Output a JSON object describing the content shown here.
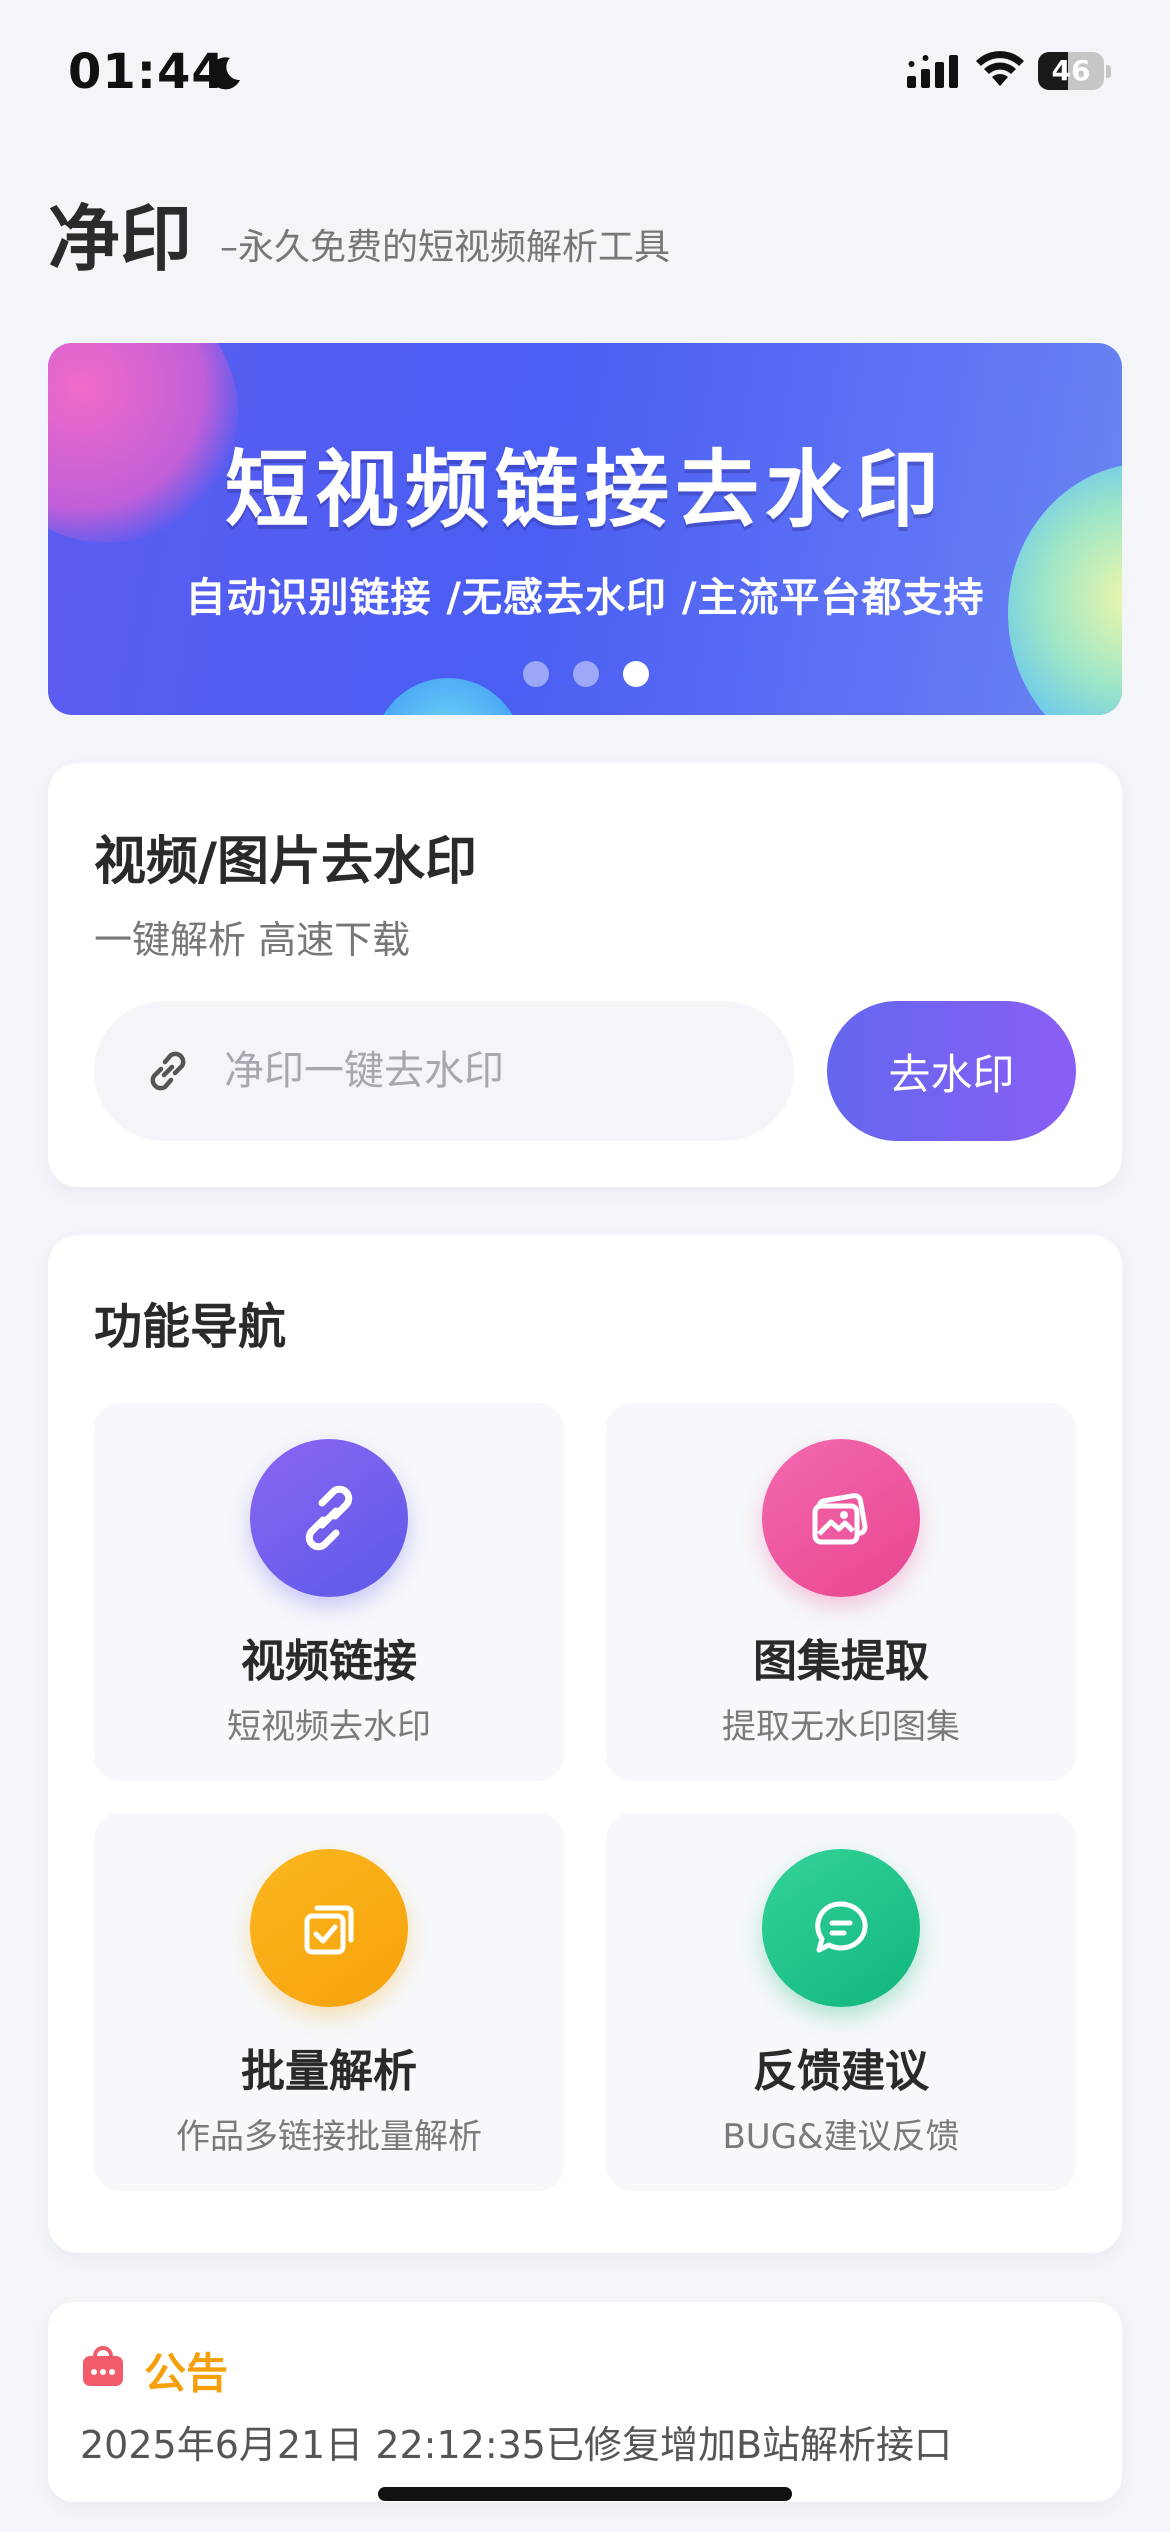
{
  "status_bar": {
    "time": "01:44",
    "battery": "46",
    "battery_level": 0.46,
    "icons": [
      "moon-icon",
      "signal-icon",
      "wifi-icon",
      "battery-icon"
    ]
  },
  "header": {
    "title": "净印",
    "subtitle": "–永久免费的短视频解析工具"
  },
  "banner": {
    "headline": "短视频链接去水印",
    "subline": "自动识别链接 /无感去水印 /主流平台都支持",
    "slide_count": 3,
    "active_slide": 3
  },
  "parse_card": {
    "title": "视频/图片去水印",
    "subtitle": "一键解析 高速下载",
    "input_placeholder": "净印一键去水印",
    "input_value": "",
    "button_label": "去水印",
    "icon": "link-icon"
  },
  "nav": {
    "title": "功能导航",
    "items": [
      {
        "label": "视频链接",
        "desc": "短视频去水印",
        "icon": "chain-link-icon",
        "color": "#6d5ef0"
      },
      {
        "label": "图集提取",
        "desc": "提取无水印图集",
        "icon": "image-gallery-icon",
        "color": "#ee5aa0"
      },
      {
        "label": "批量解析",
        "desc": "作品多链接批量解析",
        "icon": "batch-check-icon",
        "color": "#f8ab14"
      },
      {
        "label": "反馈建议",
        "desc": "BUG&建议反馈",
        "icon": "chat-bubble-icon",
        "color": "#1cc488"
      }
    ]
  },
  "notice": {
    "title": "公告",
    "text": "2025年6月21日 22:12:35已修复增加B站解析接口",
    "icon": "announcement-icon",
    "accent": "#f5a00a"
  },
  "colors": {
    "brand_gradient_start": "#6367ee",
    "brand_gradient_end": "#8a5ef5",
    "background": "#f3f5f9"
  }
}
